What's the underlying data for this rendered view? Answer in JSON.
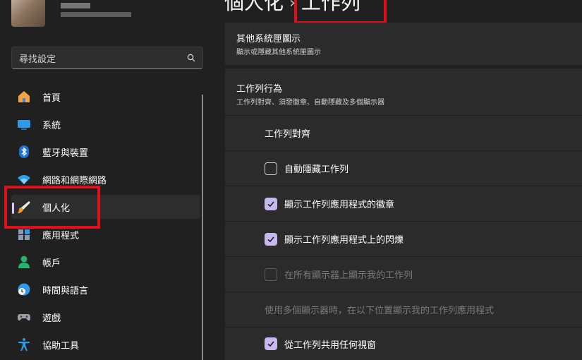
{
  "search": {
    "placeholder": "尋找設定"
  },
  "sidebar": {
    "items": [
      {
        "label": "首頁",
        "icon": "home-icon"
      },
      {
        "label": "系統",
        "icon": "monitor-icon"
      },
      {
        "label": "藍牙與裝置",
        "icon": "bluetooth-icon"
      },
      {
        "label": "網路和網際網路",
        "icon": "wifi-icon"
      },
      {
        "label": "個人化",
        "icon": "brush-icon"
      },
      {
        "label": "應用程式",
        "icon": "apps-icon"
      },
      {
        "label": "帳戶",
        "icon": "account-icon"
      },
      {
        "label": "時間與語言",
        "icon": "globe-clock-icon"
      },
      {
        "label": "遊戲",
        "icon": "gamepad-icon"
      },
      {
        "label": "協助工具",
        "icon": "accessibility-icon"
      }
    ],
    "active_index": 4
  },
  "breadcrumb": {
    "parent": "個人化",
    "separator": "›",
    "current": "工作列"
  },
  "sections": {
    "other_icons": {
      "title": "其他系統匣圖示",
      "subtitle": "顯示或隱藏其他系統匣圖示"
    },
    "behaviors": {
      "title": "工作列行為",
      "subtitle": "工作列對齊、須發徽章、自動隱藏及多個顯示器"
    }
  },
  "rows": {
    "alignment": {
      "label": "工作列對齊"
    },
    "autohide": {
      "label": "自動隱藏工作列",
      "checked": false
    },
    "badges": {
      "label": "顯示工作列應用程式的徽章",
      "checked": true
    },
    "flashing": {
      "label": "顯示工作列應用程式上的閃爍",
      "checked": true
    },
    "all_displays": {
      "label": "在所有顯示器上顯示我的工作列",
      "checked": false,
      "disabled": true
    },
    "multi_display": {
      "label": "使用多個顯示器時，在以下位置顯示我的工作列應用程式",
      "disabled": true
    },
    "share_window": {
      "label": "從工作列共用任何視窗",
      "checked": true
    }
  },
  "colors": {
    "accent": "#c8b8ee",
    "highlight_box": "#e0101a"
  }
}
